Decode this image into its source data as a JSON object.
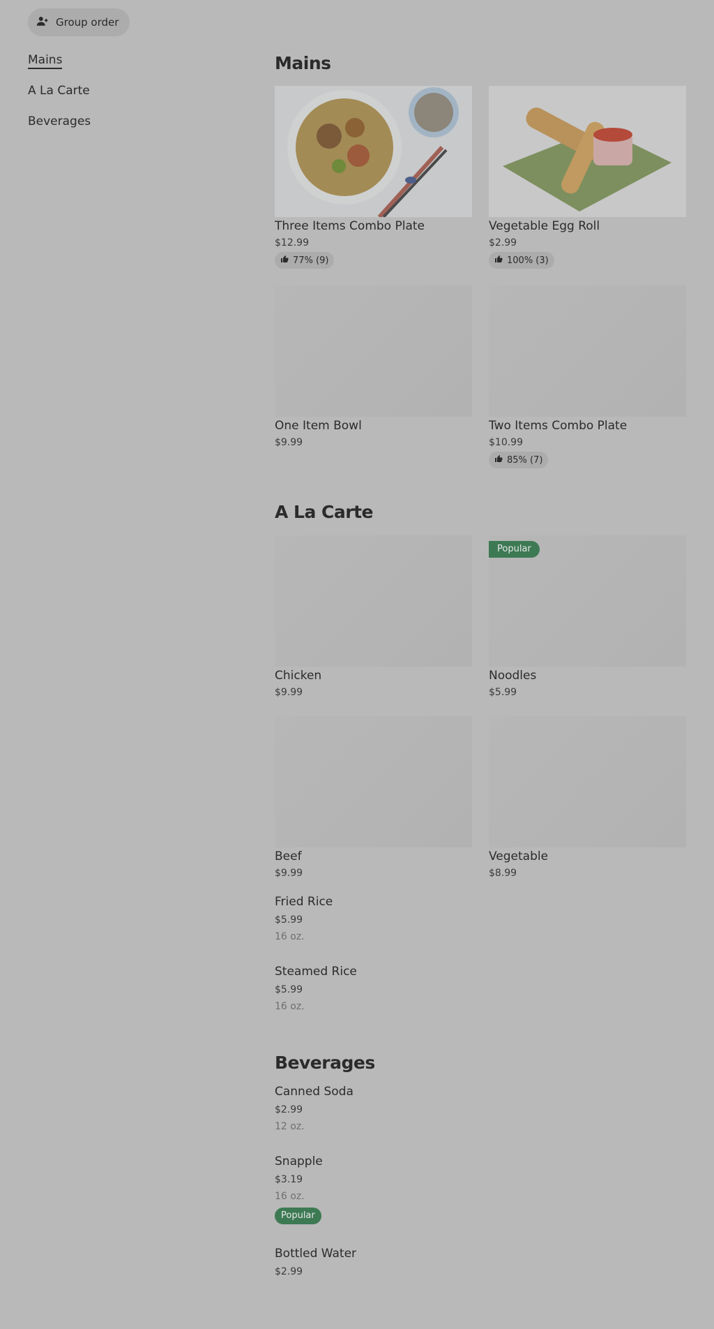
{
  "header": {
    "group_order_label": "Group order"
  },
  "sidebar": {
    "items": [
      {
        "label": "Mains"
      },
      {
        "label": "A La Carte"
      },
      {
        "label": "Beverages"
      }
    ]
  },
  "mains": {
    "title": "Mains",
    "items": [
      {
        "name": "Three Items Combo Plate",
        "price": "$12.99",
        "rating": "77% (9)"
      },
      {
        "name": "Vegetable Egg Roll",
        "price": "$2.99",
        "rating": "100% (3)"
      },
      {
        "name": "One Item Bowl",
        "price": "$9.99"
      },
      {
        "name": "Two Items Combo Plate",
        "price": "$10.99",
        "rating": "85% (7)"
      }
    ]
  },
  "alacarte": {
    "title": "A La Carte",
    "items": [
      {
        "name": "Chicken",
        "price": "$9.99"
      },
      {
        "name": "Noodles",
        "price": "$5.99",
        "badge": "Popular"
      },
      {
        "name": "Beef",
        "price": "$9.99"
      },
      {
        "name": "Vegetable",
        "price": "$8.99"
      },
      {
        "name": "Fried Rice",
        "price": "$5.99",
        "desc": "16 oz."
      },
      {
        "name": "Steamed Rice",
        "price": "$5.99",
        "desc": "16 oz."
      }
    ]
  },
  "beverages": {
    "title": "Beverages",
    "items": [
      {
        "name": "Canned Soda",
        "price": "$2.99",
        "desc": "12 oz."
      },
      {
        "name": "Snapple",
        "price": "$3.19",
        "desc": "16 oz.",
        "badge": "Popular"
      },
      {
        "name": "Bottled Water",
        "price": "$2.99"
      }
    ]
  },
  "colors": {
    "background": "#b9b9b9",
    "popular_badge": "#3d7a54",
    "text": "#2b2b2b"
  },
  "icons": {
    "group_order": "add-person-icon",
    "rating": "thumbs-up-icon"
  }
}
